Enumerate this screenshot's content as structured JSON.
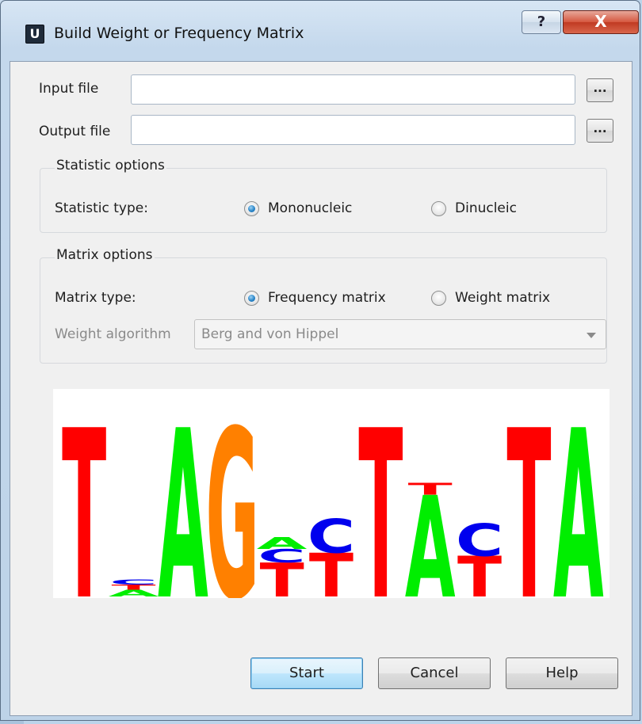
{
  "window": {
    "app_icon_letter": "U",
    "title": "Build Weight or Frequency Matrix",
    "help_glyph": "?",
    "close_glyph": "X"
  },
  "files": {
    "input_label": "Input file",
    "input_value": "",
    "output_label": "Output file",
    "output_value": "",
    "browse_label": "..."
  },
  "statistic_options": {
    "title": "Statistic options",
    "type_label": "Statistic type:",
    "options": [
      "Mononucleic",
      "Dinucleic"
    ],
    "selected": "Mononucleic"
  },
  "matrix_options": {
    "title": "Matrix options",
    "type_label": "Matrix type:",
    "options": [
      "Frequency matrix",
      "Weight matrix"
    ],
    "selected": "Frequency matrix",
    "algorithm_label": "Weight algorithm",
    "algorithm_value": "Berg and von Hippel",
    "algorithm_enabled": false
  },
  "sequence_logo": {
    "colors": {
      "T": "#ff0000",
      "A": "#00ee00",
      "G": "#ff8000",
      "C": "#0000ee"
    },
    "columns": [
      [
        {
          "letter": "T",
          "height": 1.0
        }
      ],
      [
        {
          "letter": "A",
          "height": 0.04
        },
        {
          "letter": "T",
          "height": 0.03
        },
        {
          "letter": "C",
          "height": 0.03
        }
      ],
      [
        {
          "letter": "A",
          "height": 1.0
        }
      ],
      [
        {
          "letter": "G",
          "height": 1.0
        }
      ],
      [
        {
          "letter": "T",
          "height": 0.2
        },
        {
          "letter": "C",
          "height": 0.08
        },
        {
          "letter": "A",
          "height": 0.07
        }
      ],
      [
        {
          "letter": "T",
          "height": 0.26
        },
        {
          "letter": "C",
          "height": 0.2
        }
      ],
      [
        {
          "letter": "T",
          "height": 1.0
        }
      ],
      [
        {
          "letter": "A",
          "height": 0.6
        },
        {
          "letter": "T",
          "height": 0.07
        }
      ],
      [
        {
          "letter": "T",
          "height": 0.24
        },
        {
          "letter": "C",
          "height": 0.19
        }
      ],
      [
        {
          "letter": "T",
          "height": 1.0
        }
      ],
      [
        {
          "letter": "A",
          "height": 1.0
        }
      ]
    ]
  },
  "buttons": {
    "start": "Start",
    "cancel": "Cancel",
    "help": "Help"
  }
}
